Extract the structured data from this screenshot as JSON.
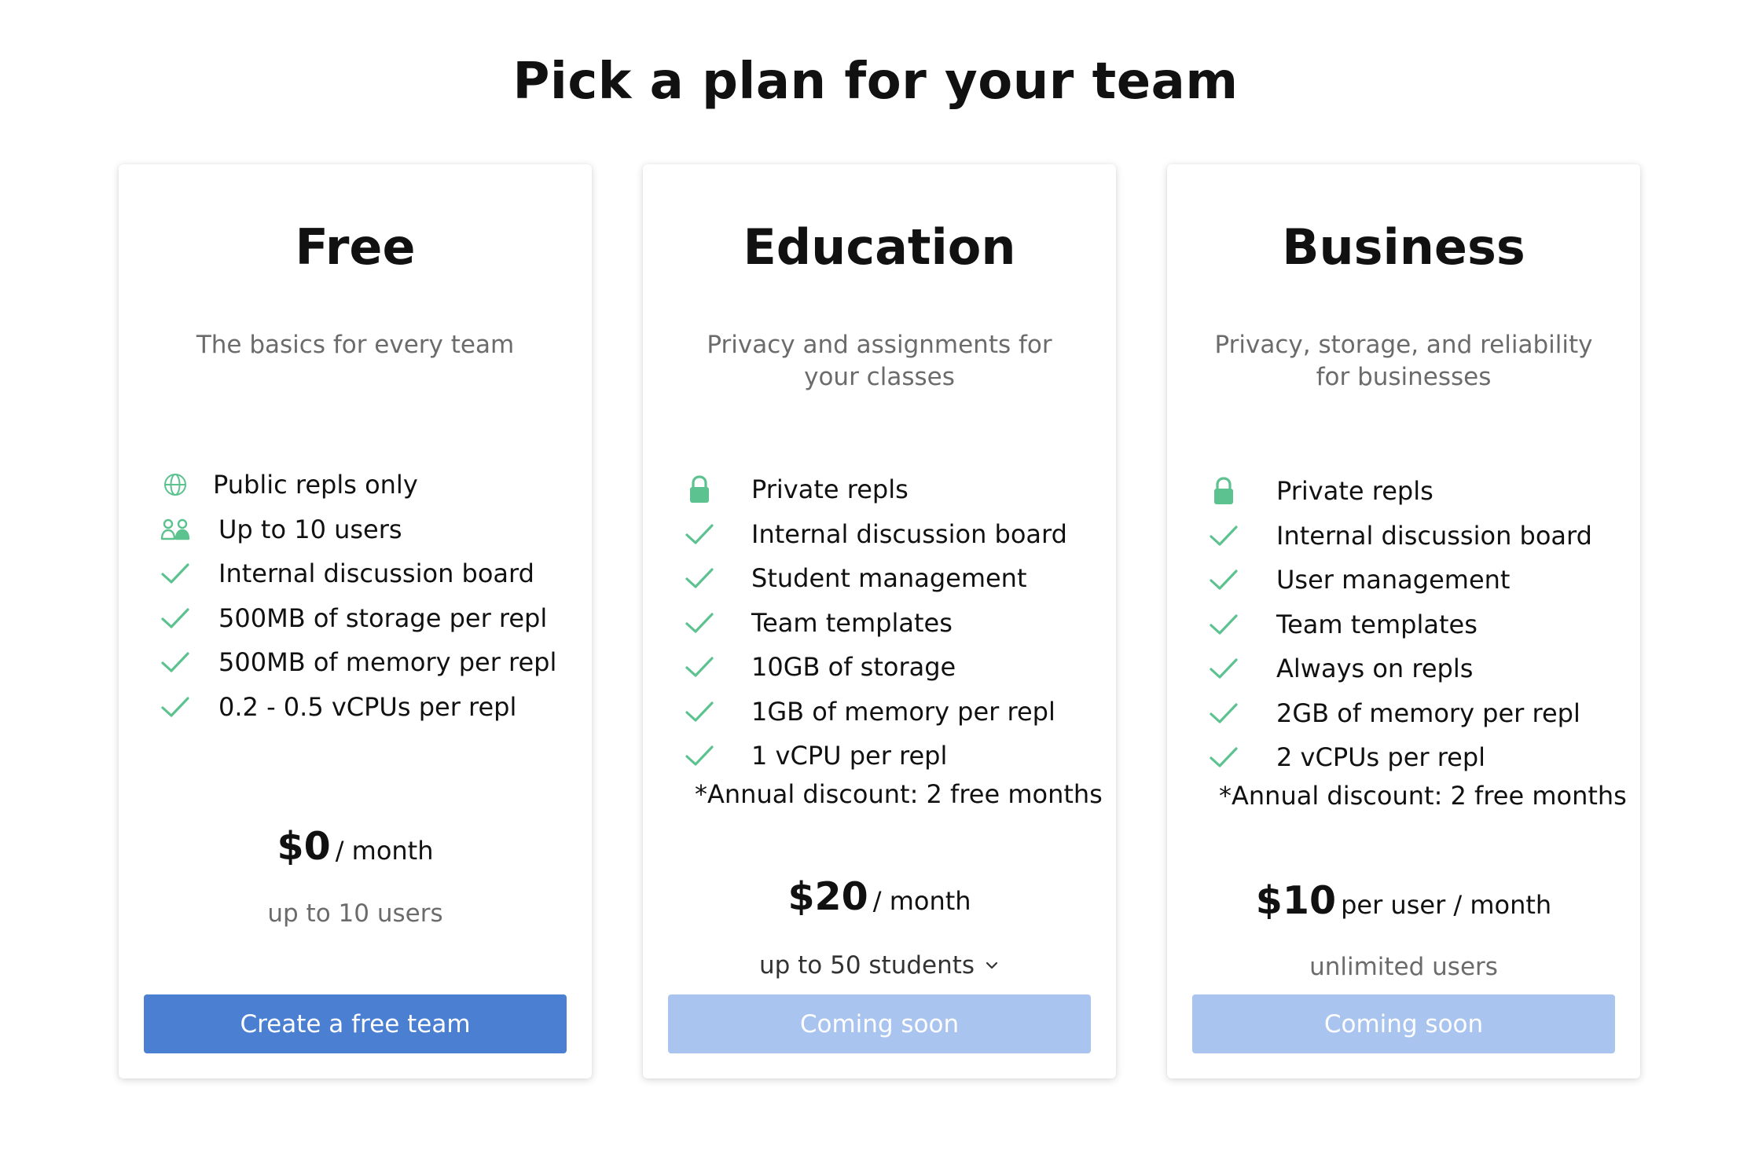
{
  "page": {
    "title": "Pick a plan for your team"
  },
  "theme": {
    "accent_blue": "#4a7fd1",
    "disabled_blue": "#a9c4ef",
    "check_green": "#5cc28f",
    "muted_text": "#6b6b6b"
  },
  "plans": [
    {
      "name": "Free",
      "description": "The basics for every team",
      "features": [
        {
          "icon": "globe-icon",
          "text": "Public repls only"
        },
        {
          "icon": "users-icon",
          "text": "Up to 10 users"
        },
        {
          "icon": "check-icon",
          "text": "Internal discussion board"
        },
        {
          "icon": "check-icon",
          "text": "500MB of storage per repl"
        },
        {
          "icon": "check-icon",
          "text": "500MB of memory per repl"
        },
        {
          "icon": "check-icon",
          "text": "0.2 - 0.5 vCPUs per repl"
        }
      ],
      "price": "$0",
      "price_period": "/ month",
      "capacity": "up to 10 users",
      "cta_label": "Create a free team",
      "cta_enabled": true
    },
    {
      "name": "Education",
      "description": "Privacy and assignments for your classes",
      "features": [
        {
          "icon": "lock-icon",
          "text": "Private repls"
        },
        {
          "icon": "check-icon",
          "text": "Internal discussion board"
        },
        {
          "icon": "check-icon",
          "text": "Student management"
        },
        {
          "icon": "check-icon",
          "text": "Team templates"
        },
        {
          "icon": "check-icon",
          "text": "10GB of storage"
        },
        {
          "icon": "check-icon",
          "text": "1GB of memory per repl"
        },
        {
          "icon": "check-icon",
          "text": "1 vCPU per repl"
        }
      ],
      "discount": "*Annual discount: 2 free months",
      "price": "$20",
      "price_period": "/ month",
      "capacity": "up to 50 students",
      "capacity_dropdown_icon": "chevron-down-icon",
      "cta_label": "Coming soon",
      "cta_enabled": false
    },
    {
      "name": "Business",
      "description": "Privacy, storage, and reliability for businesses",
      "features": [
        {
          "icon": "lock-icon",
          "text": "Private repls"
        },
        {
          "icon": "check-icon",
          "text": "Internal discussion board"
        },
        {
          "icon": "check-icon",
          "text": "User management"
        },
        {
          "icon": "check-icon",
          "text": "Team templates"
        },
        {
          "icon": "check-icon",
          "text": "Always on repls"
        },
        {
          "icon": "check-icon",
          "text": "2GB of memory per repl"
        },
        {
          "icon": "check-icon",
          "text": "2 vCPUs per repl"
        }
      ],
      "discount": "*Annual discount: 2 free months",
      "price": "$10",
      "price_period": "per user / month",
      "capacity": "unlimited users",
      "cta_label": "Coming soon",
      "cta_enabled": false
    }
  ]
}
